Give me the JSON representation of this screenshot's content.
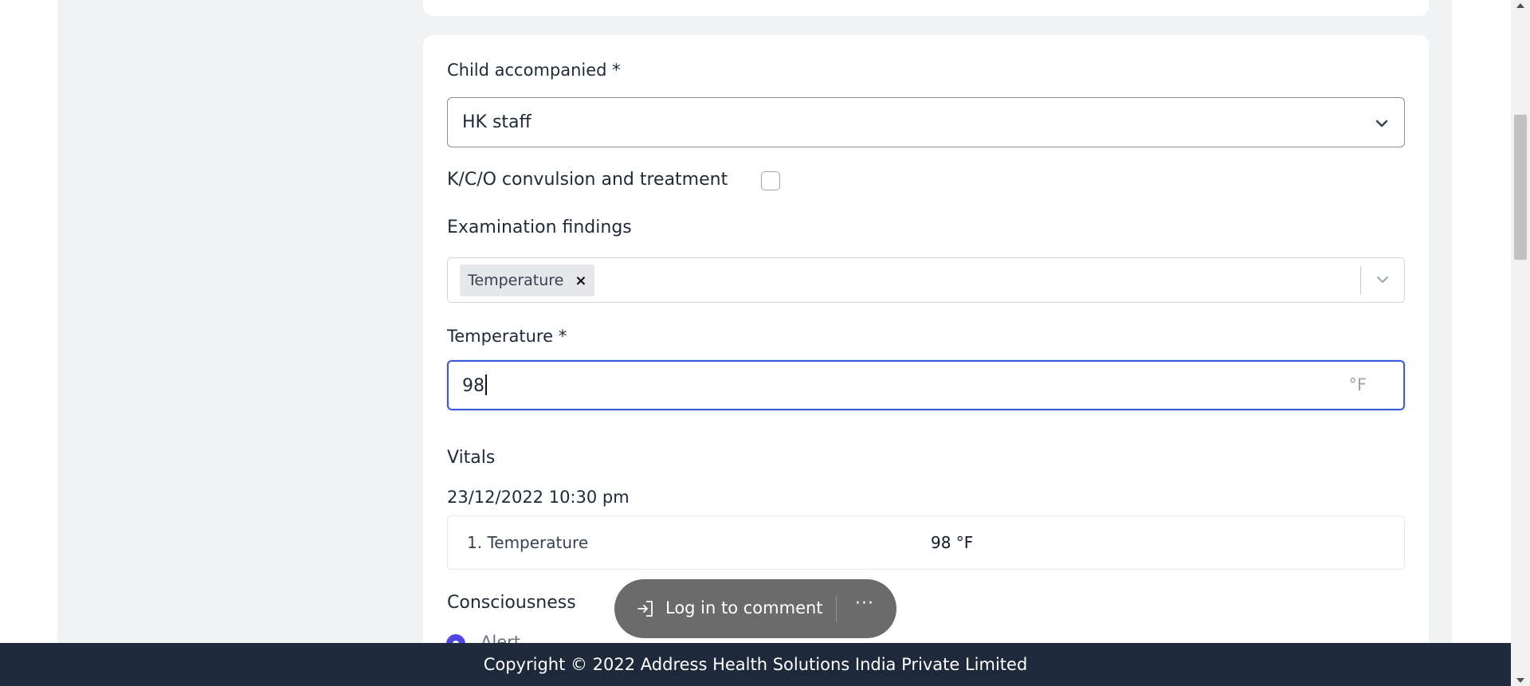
{
  "form": {
    "child_accompanied": {
      "label": "Child accompanied *",
      "value": "HK staff"
    },
    "kco_convulsion": {
      "label": "K/C/O convulsion and treatment",
      "checked": false
    },
    "examination_findings": {
      "label": "Examination findings",
      "chips": [
        "Temperature"
      ],
      "remove_symbol": "×"
    },
    "temperature": {
      "label": "Temperature *",
      "value": "98",
      "unit": "°F"
    },
    "vitals": {
      "heading": "Vitals",
      "timestamp": "23/12/2022 10:30 pm",
      "rows": [
        {
          "name": "1. Temperature",
          "value": "98 °F"
        }
      ]
    },
    "consciousness": {
      "heading": "Consciousness",
      "selected_option": "Alert"
    }
  },
  "toast": {
    "login_label": "Log in to comment",
    "more_label": "···"
  },
  "footer": {
    "copyright": "Copyright © 2022 Address Health Solutions India Private Limited"
  },
  "colors": {
    "accent": "#3b5bdb",
    "radio": "#4f46e5",
    "footer_bg": "#1e293b",
    "page_gray": "#f1f2f4"
  }
}
